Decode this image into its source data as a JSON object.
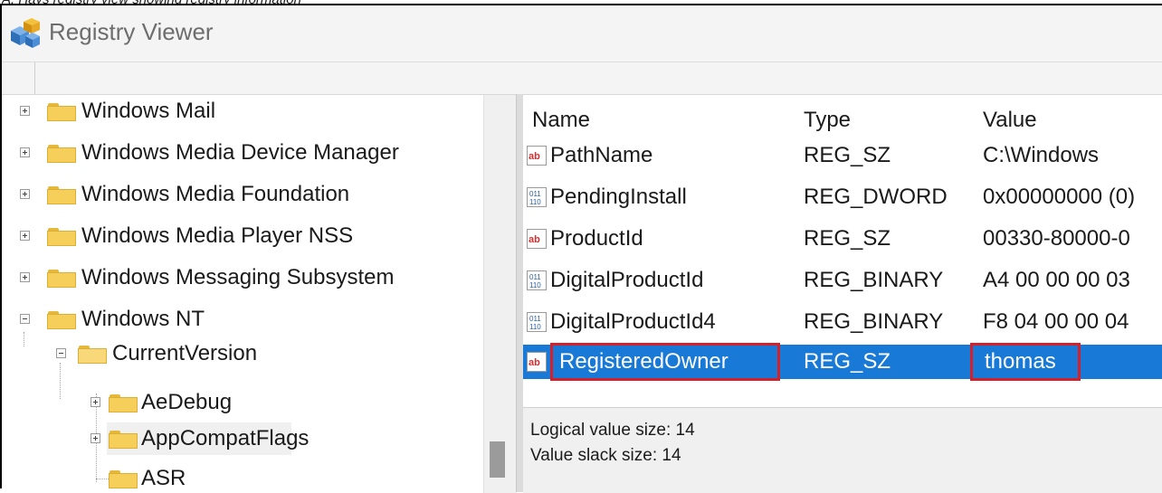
{
  "caption": "A. Hays registry view showing registry information",
  "window": {
    "title": "Registry Viewer",
    "icon": "registry-cubes-icon"
  },
  "tree": {
    "items": [
      {
        "label": "Windows Mail",
        "expander": "plus"
      },
      {
        "label": "Windows Media Device Manager",
        "expander": "plus"
      },
      {
        "label": "Windows Media Foundation",
        "expander": "plus"
      },
      {
        "label": "Windows Media Player NSS",
        "expander": "plus"
      },
      {
        "label": "Windows Messaging Subsystem",
        "expander": "plus"
      },
      {
        "label": "Windows NT",
        "expander": "minus"
      },
      {
        "label": "CurrentVersion",
        "expander": "minus"
      },
      {
        "label": "AeDebug",
        "expander": "plus"
      },
      {
        "label": "AppCompatFlags",
        "expander": "plus"
      },
      {
        "label": "ASR",
        "expander": "none"
      }
    ]
  },
  "values": {
    "headers": {
      "name": "Name",
      "type": "Type",
      "value": "Value"
    },
    "rows": [
      {
        "name": "PathName",
        "type": "REG_SZ",
        "value": "C:\\Windows",
        "icon": "string-value-icon"
      },
      {
        "name": "PendingInstall",
        "type": "REG_DWORD",
        "value": "0x00000000 (0)",
        "icon": "binary-value-icon"
      },
      {
        "name": "ProductId",
        "type": "REG_SZ",
        "value": "00330-80000-0",
        "icon": "string-value-icon"
      },
      {
        "name": "DigitalProductId",
        "type": "REG_BINARY",
        "value": "A4 00 00 00 03",
        "icon": "binary-value-icon"
      },
      {
        "name": "DigitalProductId4",
        "type": "REG_BINARY",
        "value": "F8 04 00 00 04",
        "icon": "binary-value-icon"
      },
      {
        "name": "RegisteredOwner",
        "type": "REG_SZ",
        "value": "thomas",
        "icon": "string-value-icon",
        "selected": true
      }
    ]
  },
  "status": {
    "logical_size": "Logical value size: 14",
    "slack_size": "Value slack size: 14"
  },
  "colors": {
    "selection": "#1979d6",
    "highlight_box": "#d4202a",
    "folder": "#f5cf5a"
  }
}
